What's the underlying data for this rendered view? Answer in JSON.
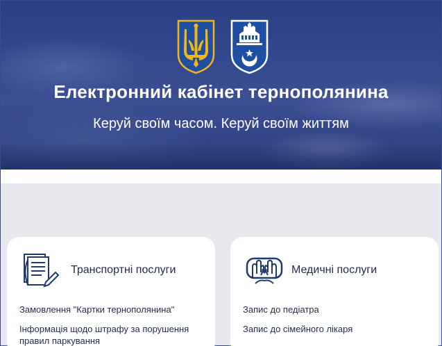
{
  "hero": {
    "title": "Електронний кабінет тернополянина",
    "subtitle": "Керуй своїм часом. Керуй своїм життям"
  },
  "cards": [
    {
      "title": "Транспортні послуги",
      "icon": "documents-pen-icon",
      "links": [
        "Замовлення \"Картки тернополянина\"",
        "Інформація щодо штрафу за порушення правил паркування"
      ]
    },
    {
      "title": "Медичні послуги",
      "icon": "hands-heart-icon",
      "links": [
        "Запис до педіатра",
        "Запис до сімейного лікаря"
      ]
    }
  ],
  "colors": {
    "hero_bg": "#34488f",
    "accent_navy": "#1e3a6e",
    "coat_blue": "#1f4fa0",
    "coat_gold": "#f2b51a"
  }
}
